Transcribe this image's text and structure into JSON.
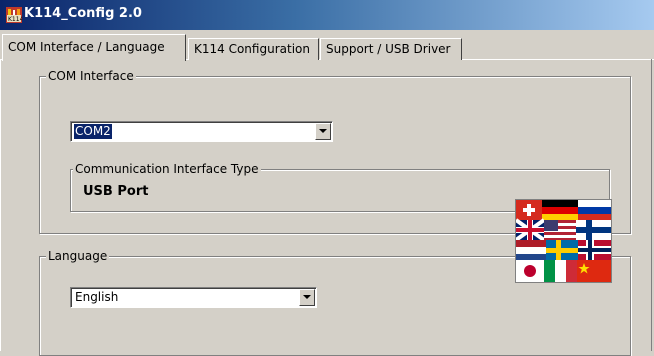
{
  "window": {
    "title": "K114_Config 2.0",
    "app_icon": "k114-app-icon"
  },
  "tabs": [
    {
      "label": "COM Interface / Language",
      "active": true
    },
    {
      "label": "K114 Configuration",
      "active": false
    },
    {
      "label": "Support / USB Driver",
      "active": false
    }
  ],
  "com_interface": {
    "group_label": "COM Interface",
    "port_value": "COM2",
    "type_group_label": "Communication Interface Type",
    "type_value": "USB Port"
  },
  "language": {
    "group_label": "Language",
    "value": "English",
    "flags_icon": "language-flags-icon"
  },
  "colors": {
    "title_start": "#0a246a",
    "title_end": "#a6caf0",
    "face": "#d4d0c8",
    "selection": "#0a246a"
  }
}
